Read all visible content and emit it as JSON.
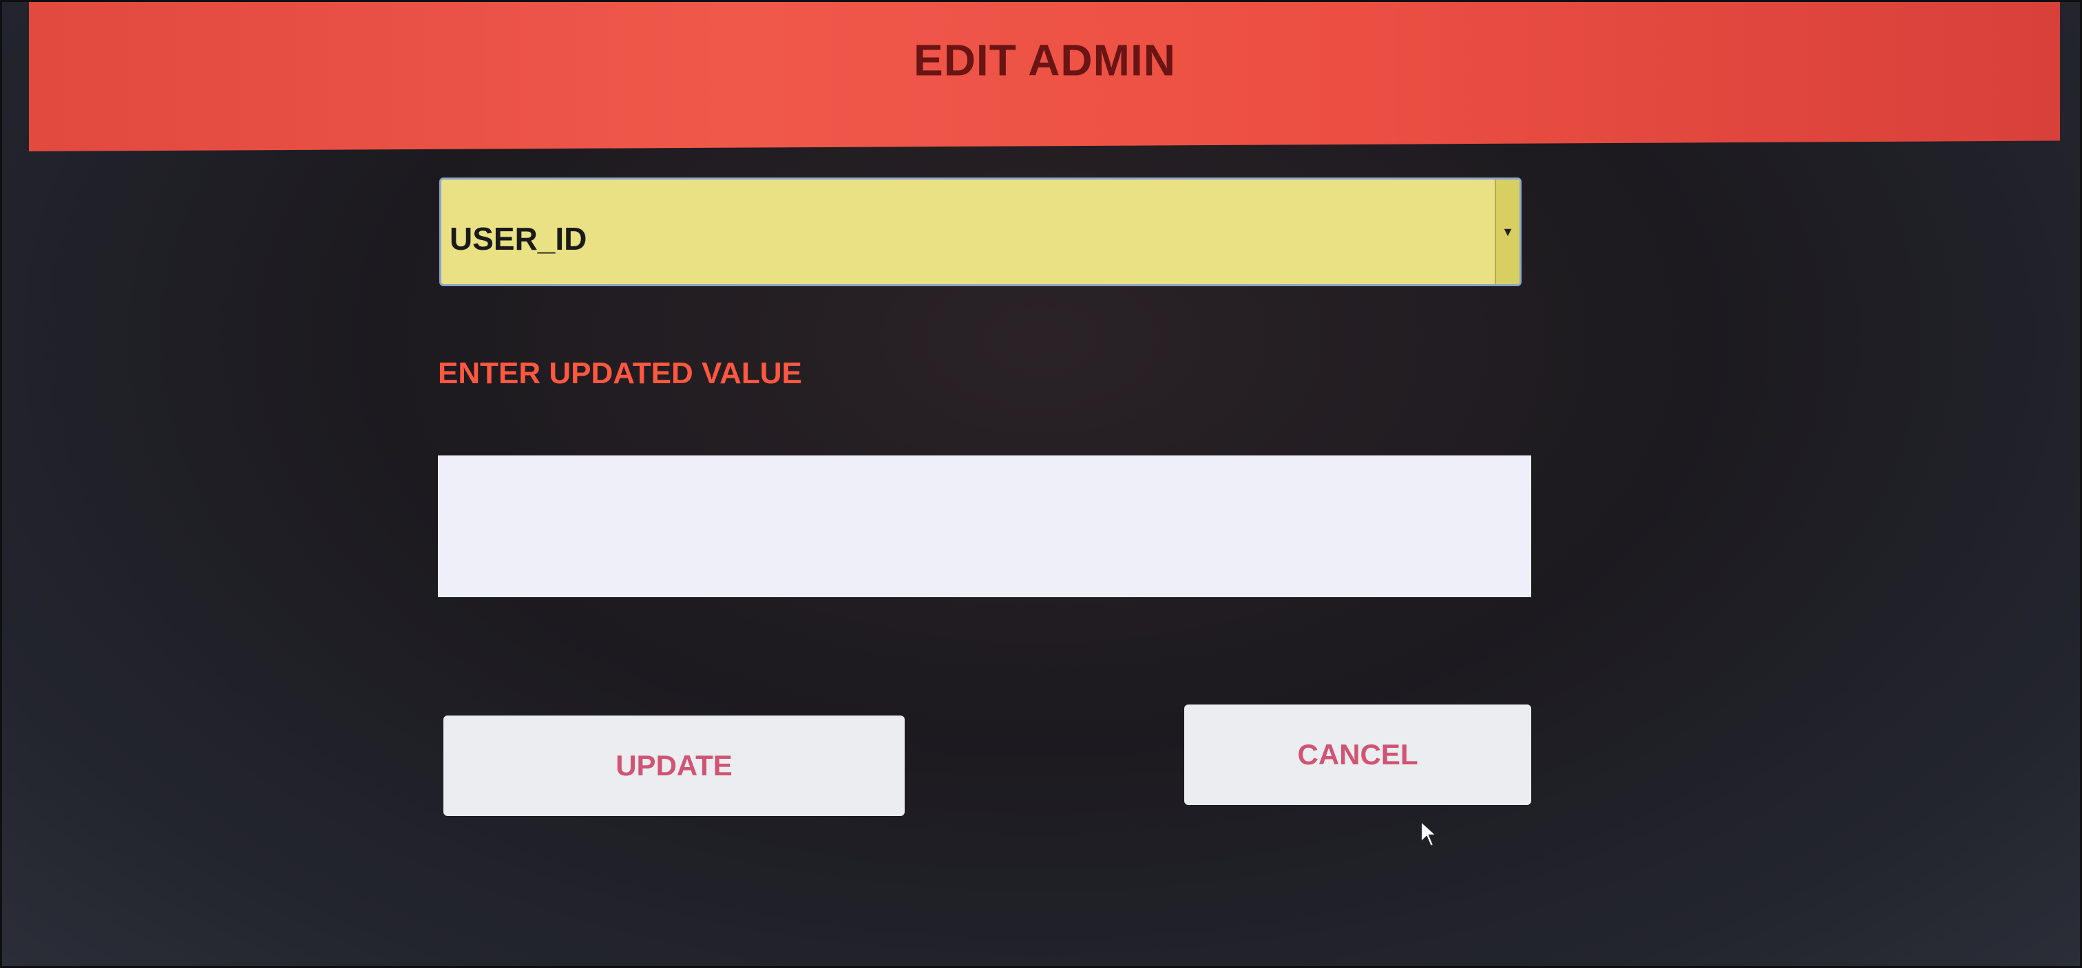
{
  "header": {
    "title": "EDIT ADMIN"
  },
  "form": {
    "field_select": {
      "selected_value": "USER_ID"
    },
    "value_label": "ENTER UPDATED VALUE",
    "value_input": {
      "value": "",
      "placeholder": ""
    }
  },
  "buttons": {
    "update_label": "UPDATE",
    "cancel_label": "CANCEL"
  },
  "colors": {
    "header_bg": "#ec4f42",
    "header_text": "#6a1414",
    "select_bg": "#e9e184",
    "label_text": "#ff5740",
    "button_bg": "#ecedf0",
    "button_text": "#d05473",
    "background": "#1c1a1f"
  },
  "icons": {
    "select_arrow": "chevron-down-icon",
    "cursor": "mouse-pointer-icon"
  }
}
